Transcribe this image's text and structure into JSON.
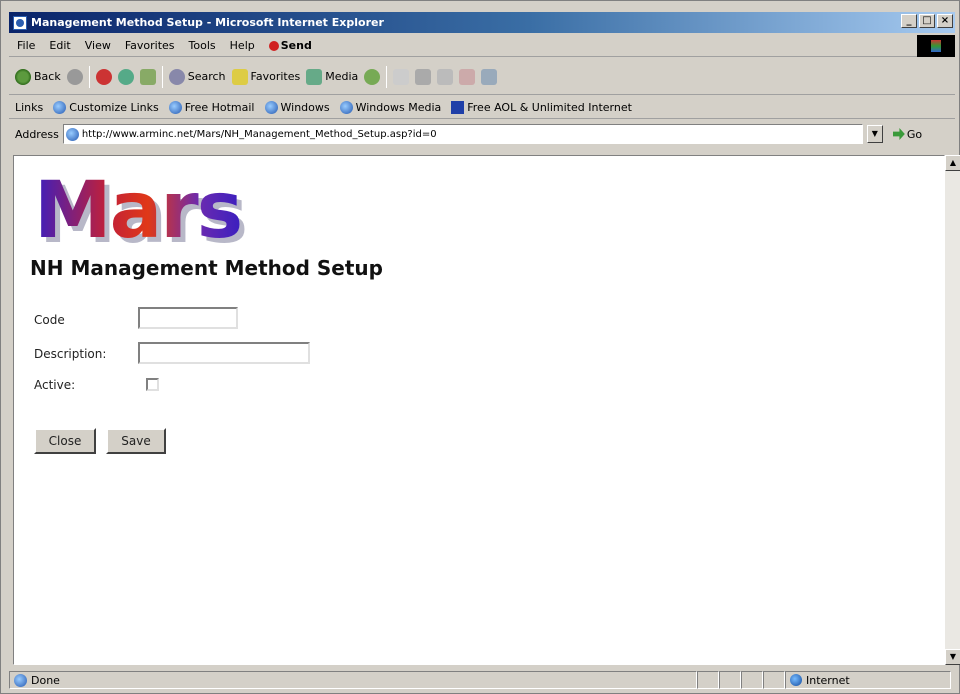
{
  "window": {
    "title": "Management Method Setup - Microsoft Internet Explorer",
    "controls": [
      "_",
      "□",
      "×"
    ]
  },
  "menu": {
    "items": [
      "File",
      "Edit",
      "View",
      "Favorites",
      "Tools",
      "Help"
    ],
    "send_label": "Send"
  },
  "toolbar": {
    "back_label": "Back",
    "search_label": "Search",
    "favorites_label": "Favorites",
    "media_label": "Media"
  },
  "links": {
    "label": "Links",
    "items": [
      "Customize Links",
      "Free Hotmail",
      "Windows",
      "Windows Media",
      "Free AOL & Unlimited Internet"
    ]
  },
  "address": {
    "label": "Address",
    "url": "http://www.arminc.net/Mars/NH_Management_Method_Setup.asp?id=0",
    "go_label": "Go"
  },
  "page": {
    "logo_text": "Mars",
    "title": "NH Management Method Setup",
    "form": {
      "code_label": "Code",
      "code_value": "",
      "description_label": "Description:",
      "description_value": "",
      "active_label": "Active:",
      "active_checked": false
    },
    "buttons": {
      "close_label": "Close",
      "save_label": "Save"
    }
  },
  "status": {
    "text": "Done",
    "zone": "Internet"
  }
}
